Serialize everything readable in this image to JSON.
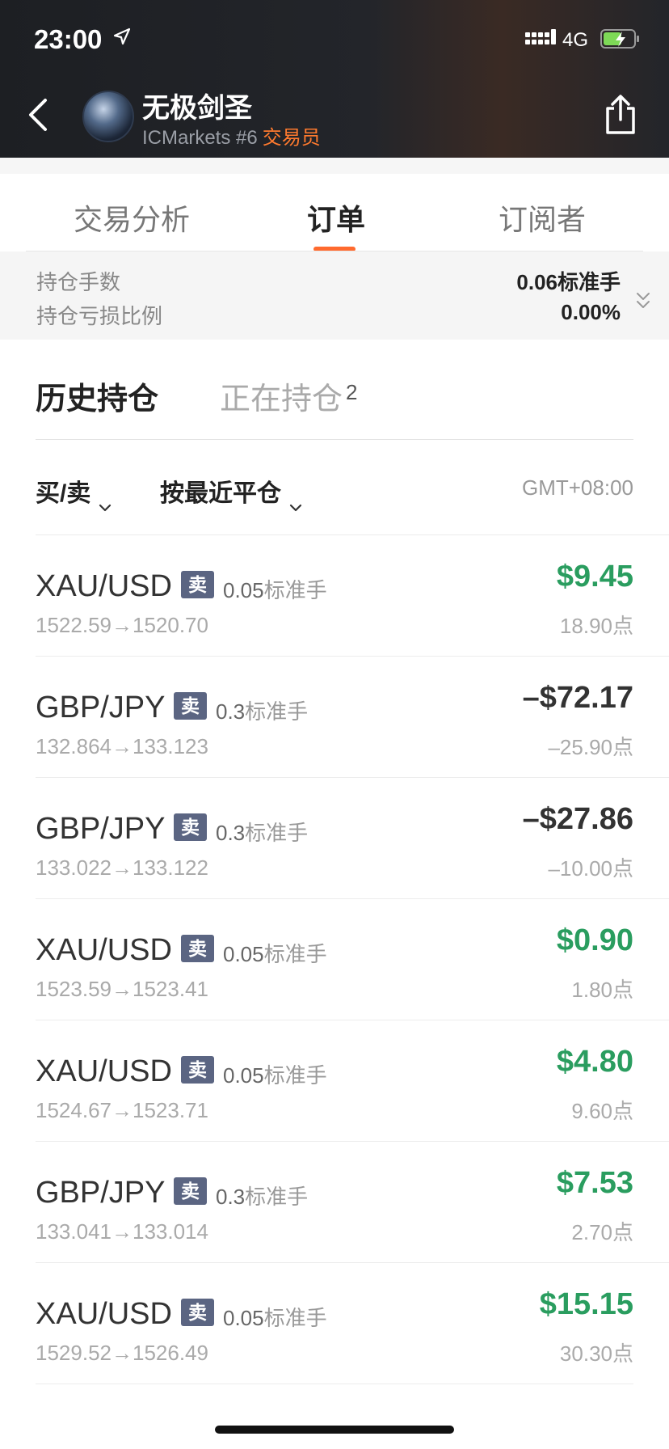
{
  "status": {
    "time": "23:00",
    "network": "4G"
  },
  "header": {
    "name": "无极剑圣",
    "broker": "ICMarkets #6",
    "role": "交易员"
  },
  "tabs": [
    {
      "label": "交易分析"
    },
    {
      "label": "订单"
    },
    {
      "label": "订阅者"
    }
  ],
  "summary": {
    "lots_label": "持仓手数",
    "lots_value": "0.06标准手",
    "ratio_label": "持仓亏损比例",
    "ratio_value": "0.00%"
  },
  "subtabs": {
    "history": "历史持仓",
    "open": "正在持仓",
    "open_count": "2"
  },
  "filters": {
    "side": "买/卖",
    "sort": "按最近平仓",
    "timezone": "GMT+08:00"
  },
  "orders": [
    {
      "symbol": "XAU/USD",
      "side": "卖",
      "lots": "0.05",
      "unit": "标准手",
      "prices": "1522.59→1520.70",
      "pl": "$9.45",
      "points": "18.90点",
      "positive": true
    },
    {
      "symbol": "GBP/JPY",
      "side": "卖",
      "lots": "0.3",
      "unit": "标准手",
      "prices": "132.864→133.123",
      "pl": "–$72.17",
      "points": "–25.90点",
      "positive": false
    },
    {
      "symbol": "GBP/JPY",
      "side": "卖",
      "lots": "0.3",
      "unit": "标准手",
      "prices": "133.022→133.122",
      "pl": "–$27.86",
      "points": "–10.00点",
      "positive": false
    },
    {
      "symbol": "XAU/USD",
      "side": "卖",
      "lots": "0.05",
      "unit": "标准手",
      "prices": "1523.59→1523.41",
      "pl": "$0.90",
      "points": "1.80点",
      "positive": true
    },
    {
      "symbol": "XAU/USD",
      "side": "卖",
      "lots": "0.05",
      "unit": "标准手",
      "prices": "1524.67→1523.71",
      "pl": "$4.80",
      "points": "9.60点",
      "positive": true
    },
    {
      "symbol": "GBP/JPY",
      "side": "卖",
      "lots": "0.3",
      "unit": "标准手",
      "prices": "133.041→133.014",
      "pl": "$7.53",
      "points": "2.70点",
      "positive": true
    },
    {
      "symbol": "XAU/USD",
      "side": "卖",
      "lots": "0.05",
      "unit": "标准手",
      "prices": "1529.52→1526.49",
      "pl": "$15.15",
      "points": "30.30点",
      "positive": true
    }
  ],
  "colors": {
    "accent": "#ff6a2e",
    "profit": "#2a9d5f",
    "badge": "#5b6582"
  }
}
